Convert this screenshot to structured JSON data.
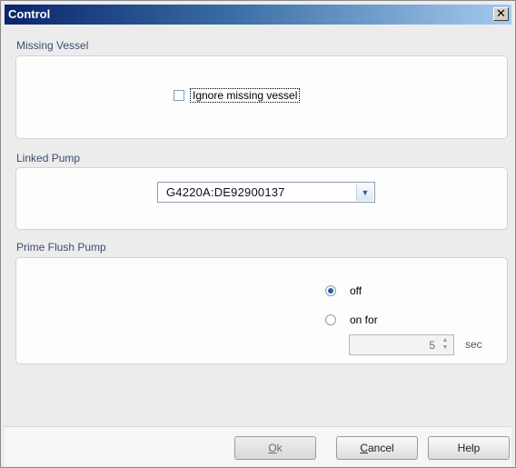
{
  "window": {
    "title": "Control",
    "close_glyph": "✕"
  },
  "missing_vessel": {
    "label": "Missing Vessel",
    "checkbox_label": "Ignore missing vessel",
    "checked": false
  },
  "linked_pump": {
    "label": "Linked Pump",
    "selected": "G4220A:DE92900137"
  },
  "prime_flush": {
    "label": "Prime Flush Pump",
    "option_off": "off",
    "option_on": "on for",
    "selected": "off",
    "duration_value": "5",
    "duration_unit": "sec"
  },
  "buttons": {
    "ok_accel": "O",
    "ok_rest": "k",
    "cancel_accel": "C",
    "cancel_rest": "ancel",
    "help": "Help"
  },
  "colors": {
    "title_gradient_start": "#0a246a",
    "title_gradient_end": "#a6caf0",
    "radio_selected": "#2a5fa8"
  }
}
